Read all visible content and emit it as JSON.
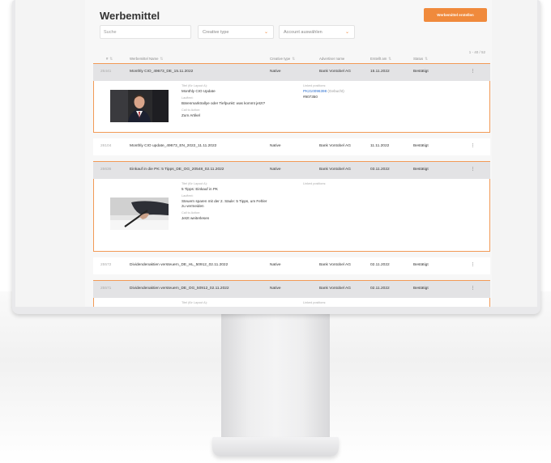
{
  "page": {
    "title": "Werbemittel",
    "create_button": "Werbemittel erstellen",
    "accent_color": "#f08a3c"
  },
  "filters": {
    "search_placeholder": "Suche",
    "creative_type": "Creative type",
    "account": "Account auswählen"
  },
  "pager": "1 - 40 / 52",
  "columns": {
    "id": "#",
    "name": "Werbemittel Name",
    "type": "Creative type",
    "advertiser": "Advertiser name",
    "created": "Erstellt am",
    "status": "Status"
  },
  "rows": [
    {
      "id": "26441",
      "name": "Monthly CIO_49673_DE_15.11.2022",
      "type": "Native",
      "advertiser": "Bank Vontobel AG",
      "created": "15.11.2022",
      "status": "Bestätigt",
      "more": "⋮",
      "detail": {
        "title_label": "Titel (für Layout A):",
        "title": "Monthly CIO Update",
        "body_label": "Lauftext:",
        "body": "Bärenmarktrallye oder Tiefpunkt: was kommt jetzt?",
        "cta_label": "Call to Action:",
        "cta": "Zum Artikel",
        "linked_label": "Linked positions:",
        "linked_code": "PK210096398",
        "linked_status": "(Gebucht)",
        "linked_ref": "#907350"
      }
    },
    {
      "id": "26104",
      "name": "Monthly CIO update_49673_EN_2022_11.11.2022",
      "type": "Native",
      "advertiser": "Bank Vontobel AG",
      "created": "11.11.2022",
      "status": "Bestätigt",
      "more": "⋮"
    },
    {
      "id": "25636",
      "name": "Einkauf in die PK: 5 Tipps_DE_OG_20548_02.11.2022",
      "type": "Native",
      "advertiser": "Bank Vontobel AG",
      "created": "03.11.2022",
      "status": "Bestätigt",
      "more": "⋮",
      "detail": {
        "title_label": "Titel (für Layout A):",
        "title": "5 Tipps: Einkauf in PK",
        "body_label": "Lauftext:",
        "body_line1": "Steuern sparen mit der 2. Säule: 5 Tipps, um Fehler",
        "body_line2": "zu vermeiden",
        "cta_label": "Call to Action:",
        "cta": "Jetzt weiterlesen",
        "linked_label": "Linked positions:"
      }
    },
    {
      "id": "25572",
      "name": "Dividendenaktien versteuern_DE_HL_50912_02.11.2022",
      "type": "Native",
      "advertiser": "Bank Vontobel AG",
      "created": "02.11.2022",
      "status": "Bestätigt",
      "more": "⋮"
    },
    {
      "id": "25571",
      "name": "Dividendenaktien versteuern_DE_OG_50912_02.11.2022",
      "type": "Native",
      "advertiser": "Bank Vontobel AG",
      "created": "02.11.2022",
      "status": "Bestätigt",
      "more": "⋮",
      "detail": {
        "title_label": "Titel (für Layout A):",
        "linked_label": "Linked positions:"
      }
    }
  ]
}
